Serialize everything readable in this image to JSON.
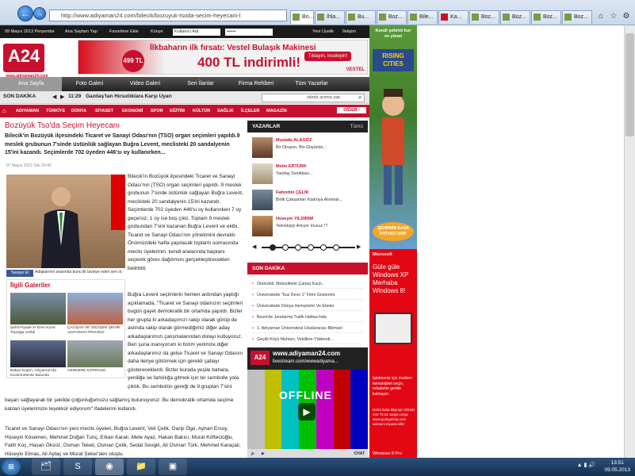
{
  "browser": {
    "url": "http://www.adiyaman24.com/bilecik/bozuyuk-tsoda-secim-heyecani-l",
    "tabs": [
      "Bo...",
      "İhla...",
      "Bu...",
      "Boz...",
      "Bile...",
      "Ka...",
      "Boz...",
      "Boz...",
      "Boz...",
      "Boz..."
    ]
  },
  "topbar": {
    "date": "09 Mayıs 2013 Perşembe",
    "home": "Ana Sayfam Yap",
    "fav": "Favorilere Ekle",
    "kunye": "Künye",
    "user_ph": "Kullanıcı Adı",
    "pass_ph": "••••••",
    "new_user": "Yeni Üyelik",
    "iletisim": "İletişim"
  },
  "logo": {
    "text": "A24",
    "sub": "www.adiyaman24.com"
  },
  "banner": {
    "l1": "İlkbaharın ilk fırsatı: Vestel Bulaşık Makinesi",
    "l2": "400 TL indirimli!",
    "btn": "Tıklayın, inceleyin!",
    "price": "499 TL",
    "brand": "VESTEL"
  },
  "nav": [
    "Ana Sayfa",
    "Foto Galeri",
    "Video Galeri",
    "Seri İlanlar",
    "Firma Rehberi",
    "Tüm Yazarlar"
  ],
  "sondakika": {
    "label": "SON DAKİKA",
    "time": "11:29",
    "text": "Gazdaş'tan Hırsızlıklara Karşı Uyarı",
    "search_ph": "sitede arama yap"
  },
  "cats": [
    "ADIYAMAN",
    "TÜRKİYE",
    "DÜNYA",
    "SİYASET",
    "EKONOMİ",
    "SPOR",
    "EĞİTİM",
    "KÜLTÜR",
    "SAĞLIK",
    "İLÇELER",
    "MAGAZİN"
  ],
  "cats_more": "DİĞER ›",
  "article": {
    "title": "Bozüyük Tso'da Seçim Heyecanı",
    "lead": "Bilecik'in Bozüyük ilçesindeki Ticaret ve Sanayi Odası'nın (TSO) organ seçimleri yapıldı.9 meslek grubunun 7'sinde üstünlük sağlayan Buğra Levent, meclisteki 20 sandalyenin 15'ini kazandı. Seçimlerde 702 üyeden 446'sı oy kullanırken...",
    "date": "07 Mayıs 2013 Salı 20:40",
    "tavsiye": "Tavsiye Et",
    "caption": "Adaşlarının arasında bunu ilk tavsiye eden sen ol.",
    "col2_a": "Bilecik'in Bozüyük ilçesindeki Ticaret ve Sanayi Odası'nın (TSO) organ seçimleri yapıldı. 9 meslek grubunun 7'sinde üstünlük sağlayan Buğra Levent, meclisteki 20 sandalyenin 15'ini kazandı. Seçimlerde 702 üyeden 446'sı oy kullanırken 7 oy geçersiz, 1 oy ise boş çıktı. Toplam 9 meslek grubundan 7'sini kazanan Buğra Levent ve ekibi, Ticaret ve Sanayi Odası'nın yönetimini devraldı. Önümüzdeki hafta yapılacak toplantı sonrasında meclis üyelerinin, kendi aralarında başkanı seçerek görev dağılımını gerçekleştirecekleri belirtildi.",
    "col2_b": "Buğra Levent seçimlerin hemen ardından yaptığı açıklamada, \"Ticaret ve Sanayi odamızın seçimleri bugün gayet demokratik bir ortamda yapıldı. Bizler her grupta ki arkadaşımızı rakip olarak görüp de aslında rakip olarak görmediğimiz diğer aday arkadaşlarımızı çalışmalarından dolayı kutluyoruz. Ben şuna inanıyorum ki bizim yerimize diğer arkadaşlarımız da gelse Ticaret ve Sanayi Odasını daha ileriye götürmek için gerekli çabayı göstereceklerdi. Bizler burada yeşile bahara, yeniliğe ve farklılığa gitmek için bir sembolle yola çıktık. Bu sembolün gereği de 9 gruptan 7'sini",
    "body2": "başarı sağlayarak bir şekilde çoğunluğumuzu sağlamış bulunuyoruz. Bu demokratik ortamda seçime katılan üyelerimize teşekkür ediyorum\" ifadelerini kullandı.",
    "body3": "Ticaret ve Sanayi Odası'nın yeni meclis üyeleri, Buğra Levent, Veli Çelik, Garip Öge, Ayhan Ersoy, Hüseyin Kösemen, Mehmet Doğan Tunç, Erkan Karalı, Mete Ayaz, Hakan Bakıcı, Murat Köftecioğlu, Fatih Koç, Hasan Öksüz, Osman Tekeli, Osman Çelik, Sedat Sevgili, Ali Osman Türk, Mehmet Karaçalı, Hüseyin Elmas, Ali Aytaç ve Murat Şeker'den oluştu."
  },
  "related": {
    "title": "İlgili Galeriler",
    "items": [
      "Şehit Piyade er Eren Kural Toprağa verildi",
      "ÇALIŞAN VE GELİŞEN ŞEHİR ADIYAMAN PROJESİ",
      "Bakan Ergün, Adıyaman'da İncelemelerde Bulundu",
      "CENDERE KÖPRÜSÜ"
    ]
  },
  "yazarlar": {
    "title": "YAZARLAR",
    "all": "Tümü",
    "items": [
      {
        "name": "Mustafa ALAGÖZ",
        "text": "Bir Okuyun, Bin Düşünün..."
      },
      {
        "name": "Metin ERTÜRK",
        "text": "Yandaş Sendikası..."
      },
      {
        "name": "Fahrettin ÇELİK",
        "text": "Birlik Çalışanları Kadroya Alınmalı..."
      },
      {
        "name": "Hüseyin YILDIRIM",
        "text": "Teknolojiyi Anlıyor musuz !?"
      }
    ]
  },
  "son": {
    "title": "SON DAKİKA",
    "items": [
      "Otomobil, Motosiklete Çarpıp Kaçtı..",
      "Üniversitede \"buz Devri 1\" Filmi Gösterimi",
      "Üniversitede Dünya Hemşireler Ve Ebeler",
      "Besni'de Jandarma Trafik Haftası'nda",
      "1. Adıyaman Üniversitesi Uluslararası Bilimsel",
      "Geçitli Köyü Muhtarı, Vekillere Yüklendi..."
    ]
  },
  "tv": {
    "logo": "A24",
    "t1": "www.adiyaman24.com",
    "t2": "livestream.com/wwwadiyama...",
    "offline": "OFFLINE",
    "chat": "CHAT"
  },
  "ad1": {
    "t1": "Kendi şehrini kur ve yönet",
    "t2": "RISING CITIES",
    "t3": "ŞEHRİNİN SANA İHTİYACI VAR!"
  },
  "ad2": {
    "m": "Microsoft",
    "t": "Güle güle Windows XP Merhaba Windows 8!",
    "t4": "İşletmeniz için modern teknolojileri seçin, rekabette geride kalmayın.",
    "t5": "Daha fazla bilgi için (0216) 444 75 81 arayın veya www.gulegulexp.com adresini ziyaret edin",
    "t6": "Windows 8 Pro"
  },
  "clock": {
    "time": "13:51",
    "date": "09.05.2013"
  }
}
